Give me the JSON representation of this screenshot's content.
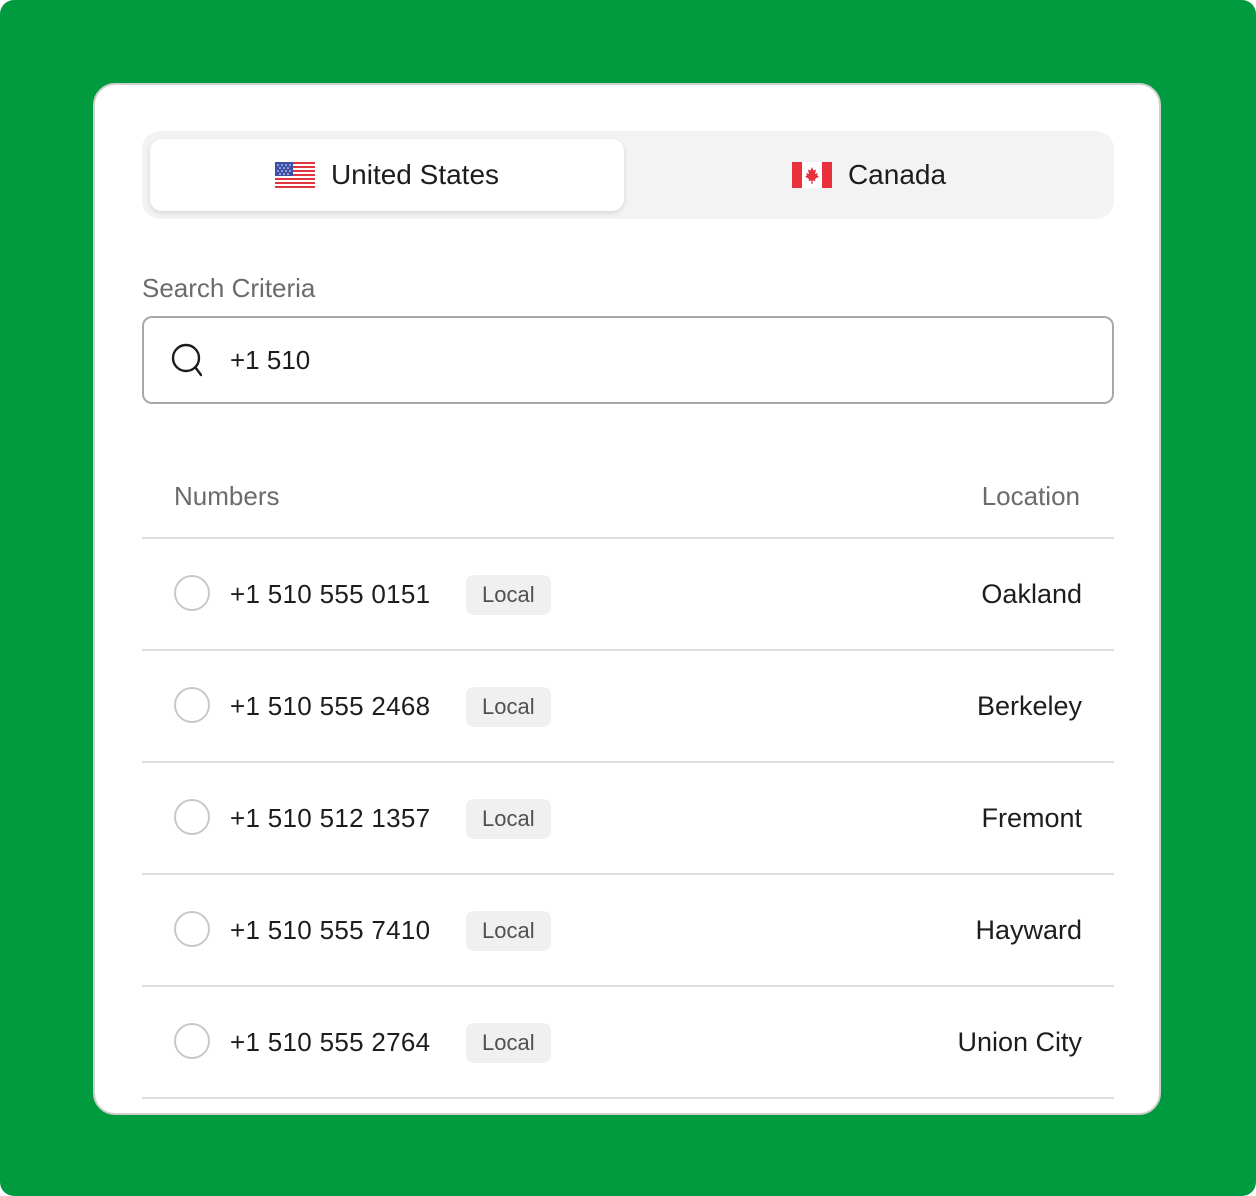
{
  "country_tabs": [
    {
      "label": "United States",
      "flag": "us-flag-icon",
      "selected": true
    },
    {
      "label": "Canada",
      "flag": "canada-flag-icon",
      "selected": false
    }
  ],
  "search": {
    "label": "Search Criteria",
    "value": "+1 510",
    "icon": "search-icon"
  },
  "table": {
    "headers": {
      "numbers": "Numbers",
      "location": "Location"
    },
    "rows": [
      {
        "number": "+1 510 555 0151",
        "type": "Local",
        "location": "Oakland"
      },
      {
        "number": "+1 510 555 2468",
        "type": "Local",
        "location": "Berkeley"
      },
      {
        "number": "+1 510 512 1357",
        "type": "Local",
        "location": "Fremont"
      },
      {
        "number": "+1 510 555 7410",
        "type": "Local",
        "location": "Hayward"
      },
      {
        "number": "+1 510 555 2764",
        "type": "Local",
        "location": "Union City"
      }
    ]
  },
  "colors": {
    "frame_background": "#009b3e",
    "card_background": "#ffffff",
    "canada_red": "#e8313c",
    "us_blue": "#3c4fa8",
    "us_red": "#e0343f"
  }
}
